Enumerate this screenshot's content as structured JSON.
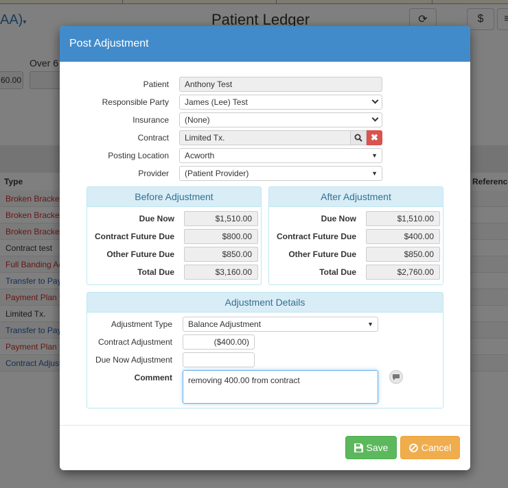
{
  "background": {
    "user_menu": "AA)",
    "page_title": "Patient Ledger",
    "aging_label": "Over 6",
    "aging_value": "60.00",
    "col_type": "Type",
    "col_reference": "Reference",
    "rows": [
      {
        "text": "Broken Bracke",
        "color": "#c9302c"
      },
      {
        "text": "Broken Bracke",
        "color": "#c9302c"
      },
      {
        "text": "Broken Bracke",
        "color": "#c9302c"
      },
      {
        "text": "Contract test",
        "color": "#333333"
      },
      {
        "text": "Full Banding Ad",
        "color": "#c9302c"
      },
      {
        "text": "Transfer to Pay",
        "color": "#2a5db0"
      },
      {
        "text": "Payment Plan f",
        "color": "#c9302c"
      },
      {
        "text": "Limited Tx.",
        "color": "#333333"
      },
      {
        "text": "Transfer to Pay",
        "color": "#2a5db0"
      },
      {
        "text": "Payment Plan f",
        "color": "#c9302c"
      },
      {
        "text": "Contract Adjust",
        "color": "#2a5db0"
      }
    ],
    "btn_dollar": "$"
  },
  "modal": {
    "title": "Post Adjustment",
    "patient_label": "Patient",
    "patient_value": "Anthony Test",
    "responsible_label": "Responsible Party",
    "responsible_value": "James (Lee) Test",
    "insurance_label": "Insurance",
    "insurance_value": "(None)",
    "contract_label": "Contract",
    "contract_value": "Limited Tx.",
    "location_label": "Posting Location",
    "location_value": "Acworth",
    "provider_label": "Provider",
    "provider_value": "(Patient Provider)"
  },
  "before": {
    "heading": "Before Adjustment",
    "due_now_label": "Due Now",
    "due_now": "$1,510.00",
    "contract_future_label": "Contract Future Due",
    "contract_future": "$800.00",
    "other_future_label": "Other Future Due",
    "other_future": "$850.00",
    "total_label": "Total Due",
    "total": "$3,160.00"
  },
  "after": {
    "heading": "After Adjustment",
    "due_now_label": "Due Now",
    "due_now": "$1,510.00",
    "contract_future_label": "Contract Future Due",
    "contract_future": "$400.00",
    "other_future_label": "Other Future Due",
    "other_future": "$850.00",
    "total_label": "Total Due",
    "total": "$2,760.00"
  },
  "details": {
    "heading": "Adjustment Details",
    "type_label": "Adjustment Type",
    "type_value": "Balance Adjustment",
    "contract_adj_label": "Contract Adjustment",
    "contract_adj_value": "($400.00)",
    "due_now_adj_label": "Due Now Adjustment",
    "due_now_adj_value": "",
    "comment_label": "Comment",
    "comment_value": "removing 400.00 from contract"
  },
  "buttons": {
    "save": "Save",
    "cancel": "Cancel"
  },
  "colors": {
    "header": "#428bca",
    "save": "#5cb85c",
    "cancel": "#f0ad4e",
    "panel_heading": "#d9edf7"
  }
}
